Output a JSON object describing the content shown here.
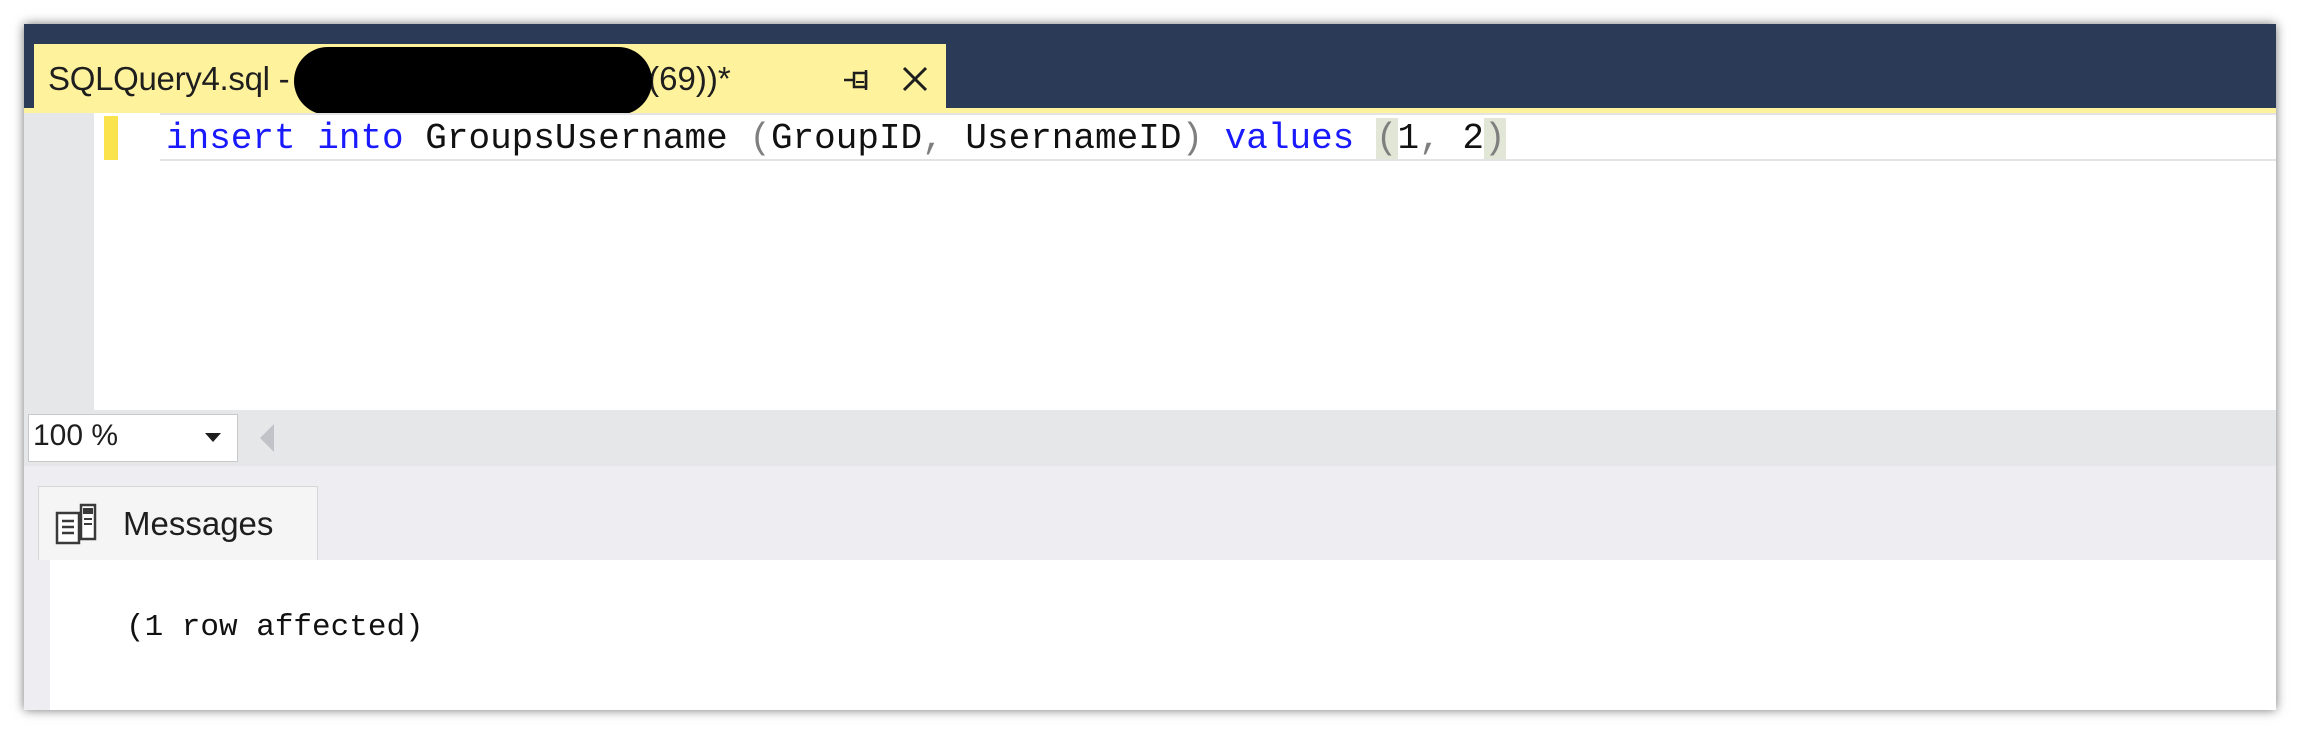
{
  "document_tab": {
    "title_prefix": "SQLQuery4.sql - ",
    "title_suffix": "(69))*",
    "pin_icon": "pin-icon",
    "close_icon": "close-icon"
  },
  "editor": {
    "code": {
      "kw_insert": "insert",
      "kw_into": "into",
      "table": "GroupsUsername",
      "col_group": "GroupID",
      "col_username": "UsernameID",
      "kw_values": "values",
      "val_1": "1",
      "val_2": "2"
    }
  },
  "zoom": {
    "value": "100 %"
  },
  "results": {
    "tab_label": "Messages",
    "tab_icon": "messages-icon",
    "message": "(1 row affected)"
  },
  "colors": {
    "tabstrip": "#2b3a56",
    "active_tab": "#fff29d",
    "keyword": "#1a1aff"
  }
}
